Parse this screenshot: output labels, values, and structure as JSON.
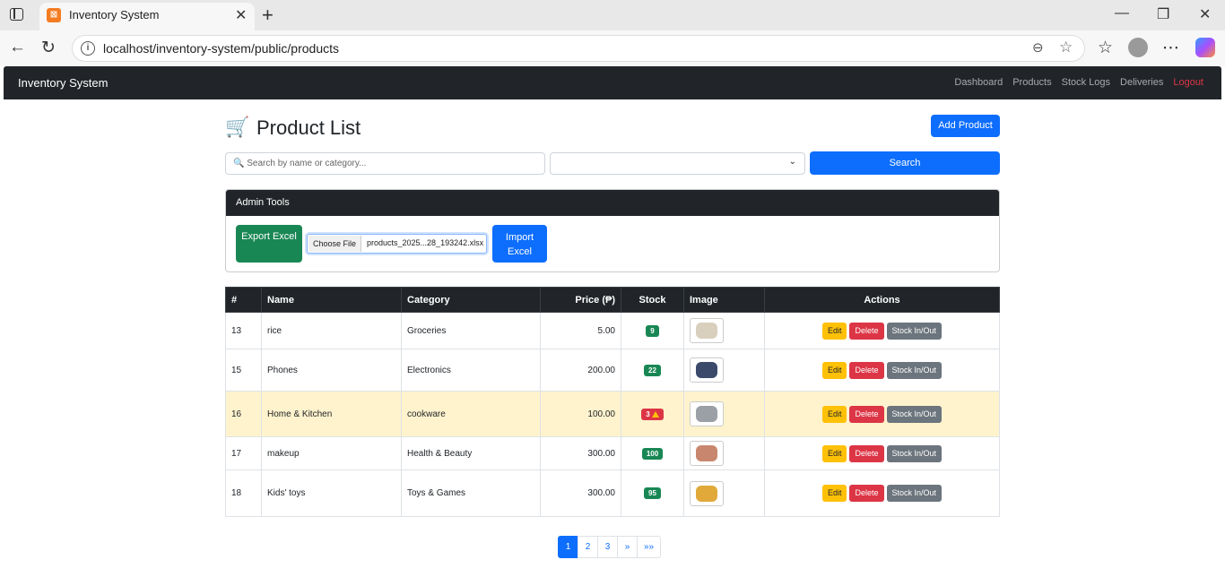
{
  "browser": {
    "tab_title": "Inventory System",
    "tab_favicon": "XAMPP",
    "url": "localhost/inventory-system/public/products"
  },
  "navbar": {
    "brand": "Inventory System",
    "links": [
      {
        "label": "Dashboard"
      },
      {
        "label": "Products"
      },
      {
        "label": "Stock Logs"
      },
      {
        "label": "Deliveries"
      },
      {
        "label": "Logout"
      }
    ]
  },
  "page": {
    "title": "Product List",
    "title_icon": "shopping-cart-icon",
    "add_button": "Add Product"
  },
  "search": {
    "placeholder": "🔍 Search by name or category...",
    "select_value": "",
    "button": "Search"
  },
  "admin_tools": {
    "header": "Admin Tools",
    "export_button": "Export Excel",
    "file_button": "Choose File",
    "file_name": "products_2025...28_193242.xlsx",
    "import_button": "Import Excel"
  },
  "table": {
    "headers": [
      "#",
      "Name",
      "Category",
      "Price (₱)",
      "Stock",
      "Image",
      "Actions"
    ],
    "rows": [
      {
        "id": "13",
        "name": "rice",
        "category": "Groceries",
        "price": "5.00",
        "stock": "9",
        "low": false,
        "image_color": "#d8cfbd"
      },
      {
        "id": "15",
        "name": "Phones",
        "category": "Electronics",
        "price": "200.00",
        "stock": "22",
        "low": false,
        "image_color": "#3b4a6b"
      },
      {
        "id": "16",
        "name": "Home & Kitchen",
        "category": "cookware",
        "price": "100.00",
        "stock": "3",
        "low": true,
        "image_color": "#9aa0a6"
      },
      {
        "id": "17",
        "name": "makeup",
        "category": "Health & Beauty",
        "price": "300.00",
        "stock": "100",
        "low": false,
        "image_color": "#c9866e"
      },
      {
        "id": "18",
        "name": "Kids' toys",
        "category": "Toys & Games",
        "price": "300.00",
        "stock": "95",
        "low": false,
        "image_color": "#e0a93a"
      }
    ],
    "actions": {
      "edit": "Edit",
      "delete": "Delete",
      "stock": "Stock In/Out"
    }
  },
  "pagination": [
    "1",
    "2",
    "3",
    "»",
    "»»"
  ],
  "colors": {
    "primary": "#0d6efd",
    "success": "#198754",
    "danger": "#dc3545",
    "warning": "#ffc107",
    "secondary": "#6c757d",
    "dark": "#212529",
    "highlight_row": "#fff3cd"
  }
}
